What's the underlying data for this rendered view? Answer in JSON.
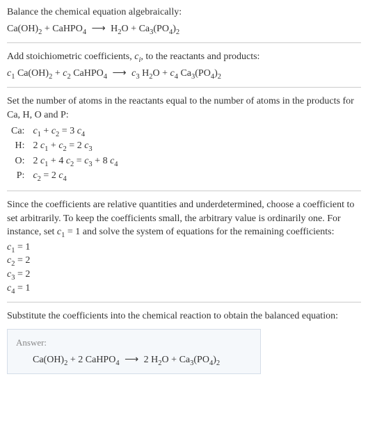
{
  "header": {
    "instruction": "Balance the chemical equation algebraically:",
    "equation_lhs_1": "Ca(OH)",
    "equation_lhs_1_sub": "2",
    "equation_plus": " + ",
    "equation_lhs_2": "CaHPO",
    "equation_lhs_2_sub": "4",
    "arrow": "⟶",
    "equation_rhs_1": "H",
    "equation_rhs_1_sub": "2",
    "equation_rhs_1b": "O",
    "equation_rhs_2": "Ca",
    "equation_rhs_2_sub": "3",
    "equation_rhs_2b": "(PO",
    "equation_rhs_2b_sub": "4",
    "equation_rhs_2c": ")",
    "equation_rhs_2c_sub": "2"
  },
  "step1": {
    "text_a": "Add stoichiometric coefficients, ",
    "ci": "c",
    "ci_sub": "i",
    "text_b": ", to the reactants and products:",
    "c1": "c",
    "c1_sub": "1",
    "c2": "c",
    "c2_sub": "2",
    "c3": "c",
    "c3_sub": "3",
    "c4": "c",
    "c4_sub": "4"
  },
  "step2": {
    "text": "Set the number of atoms in the reactants equal to the number of atoms in the products for Ca, H, O and P:",
    "rows": [
      {
        "el": "Ca:",
        "c1": "c",
        "s1": "1",
        "mid1": " + ",
        "c2": "c",
        "s2": "2",
        "eq": " = 3 ",
        "c3": "c",
        "s3": "4"
      },
      {
        "el": "H:",
        "pre": "2 ",
        "c1": "c",
        "s1": "1",
        "mid1": " + ",
        "c2": "c",
        "s2": "2",
        "eq": " = 2 ",
        "c3": "c",
        "s3": "3"
      },
      {
        "el": "O:",
        "pre": "2 ",
        "c1": "c",
        "s1": "1",
        "mid1": " + 4 ",
        "c2": "c",
        "s2": "2",
        "eq": " = ",
        "c3": "c",
        "s3": "3",
        "mid2": " + 8 ",
        "c4": "c",
        "s4": "4"
      },
      {
        "el": "P:",
        "c1": "c",
        "s1": "2",
        "eq": " = 2 ",
        "c3": "c",
        "s3": "4"
      }
    ]
  },
  "step3": {
    "text_a": "Since the coefficients are relative quantities and underdetermined, choose a coefficient to set arbitrarily. To keep the coefficients small, the arbitrary value is ordinarily one. For instance, set ",
    "c1": "c",
    "c1_sub": "1",
    "text_b": " = 1 and solve the system of equations for the remaining coefficients:",
    "results": [
      {
        "c": "c",
        "s": "1",
        "v": " = 1"
      },
      {
        "c": "c",
        "s": "2",
        "v": " = 2"
      },
      {
        "c": "c",
        "s": "3",
        "v": " = 2"
      },
      {
        "c": "c",
        "s": "4",
        "v": " = 1"
      }
    ]
  },
  "step4": {
    "text": "Substitute the coefficients into the chemical reaction to obtain the balanced equation:"
  },
  "answer": {
    "label": "Answer:",
    "lhs_1": "Ca(OH)",
    "lhs_1_sub": "2",
    "plus1": " + 2 ",
    "lhs_2": "CaHPO",
    "lhs_2_sub": "4",
    "arrow": "⟶",
    "rhs_pre": " 2 ",
    "rhs_1": "H",
    "rhs_1_sub": "2",
    "rhs_1b": "O",
    "plus2": " + ",
    "rhs_2": "Ca",
    "rhs_2_sub": "3",
    "rhs_2b": "(PO",
    "rhs_2b_sub": "4",
    "rhs_2c": ")",
    "rhs_2c_sub": "2"
  }
}
